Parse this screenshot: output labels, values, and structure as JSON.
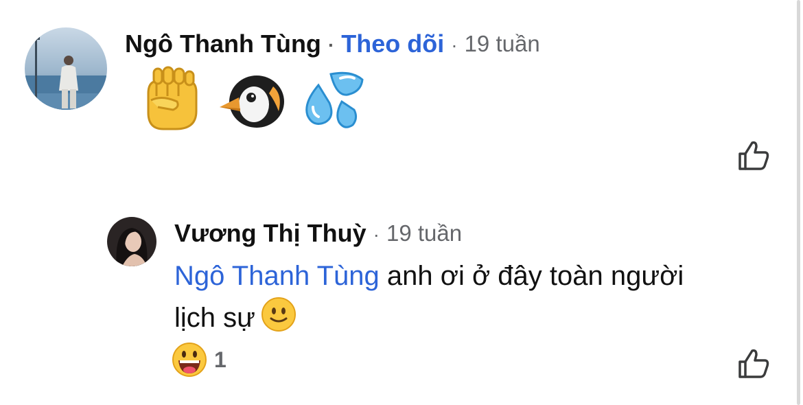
{
  "comment": {
    "author": "Ngô Thanh Tùng",
    "separator": "·",
    "follow_label": "Theo dõi",
    "time": "19 tuần",
    "emojis": [
      "raised-fist-icon",
      "penguin-icon",
      "sweat-droplets-icon"
    ]
  },
  "reply": {
    "author": "Vương Thị Thuỳ",
    "separator": "·",
    "time": "19 tuần",
    "mention": "Ngô Thanh Tùng",
    "text_line1": " anh ơi ở đây toàn người",
    "text_line2": "lịch sự",
    "trailing_emoji": "slightly-smiling-face-icon",
    "reaction_emoji": "grinning-face-icon",
    "reaction_count": "1"
  },
  "colors": {
    "link_blue": "#2d64d8",
    "meta_gray": "#65676b",
    "text": "#111111",
    "background": "#ffffff"
  },
  "icons": {
    "like": "thumbs-up-outline-icon"
  }
}
